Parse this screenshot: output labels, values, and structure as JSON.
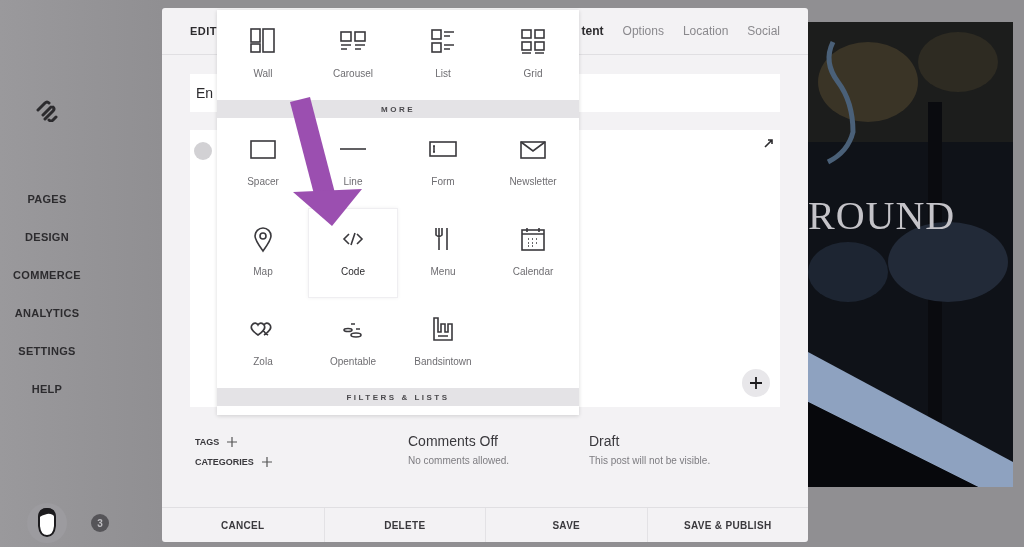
{
  "sidebar": {
    "items": [
      {
        "label": "PAGES"
      },
      {
        "label": "DESIGN"
      },
      {
        "label": "COMMERCE"
      },
      {
        "label": "ANALYTICS"
      },
      {
        "label": "SETTINGS"
      },
      {
        "label": "HELP"
      }
    ],
    "badge": "3"
  },
  "editor": {
    "heading": "EDIT",
    "tabs": [
      {
        "label": "tent",
        "selected": true
      },
      {
        "label": "Options",
        "selected": false
      },
      {
        "label": "Location",
        "selected": false
      },
      {
        "label": "Social",
        "selected": false
      }
    ],
    "title_field": {
      "value": "En"
    },
    "tags": "TAGS",
    "categories": "CATEGORIES",
    "comments": {
      "title": "Comments Off",
      "note": "No comments allowed."
    },
    "status": {
      "title": "Draft",
      "note": "This post will not be visible."
    },
    "buttons": [
      "CANCEL",
      "DELETE",
      "SAVE",
      "SAVE & PUBLISH"
    ]
  },
  "block_menu": {
    "groups": [
      {
        "items": [
          {
            "label": "Wall",
            "selected": false
          },
          {
            "label": "Carousel",
            "selected": false
          },
          {
            "label": "List",
            "selected": false
          },
          {
            "label": "Grid",
            "selected": false
          }
        ]
      },
      {
        "heading": "MORE",
        "items": [
          {
            "label": "Spacer",
            "selected": false
          },
          {
            "label": "Line",
            "selected": false
          },
          {
            "label": "Form",
            "selected": false
          },
          {
            "label": "Newsletter",
            "selected": false
          },
          {
            "label": "Map",
            "selected": false
          },
          {
            "label": "Code",
            "selected": true
          },
          {
            "label": "Menu",
            "selected": false
          },
          {
            "label": "Calendar",
            "selected": false
          },
          {
            "label": "Zola",
            "selected": false
          },
          {
            "label": "Opentable",
            "selected": false
          },
          {
            "label": "Bandsintown",
            "selected": false
          }
        ]
      },
      {
        "heading": "FILTERS & LISTS"
      }
    ]
  },
  "preview": {
    "heading": "ROUND"
  }
}
